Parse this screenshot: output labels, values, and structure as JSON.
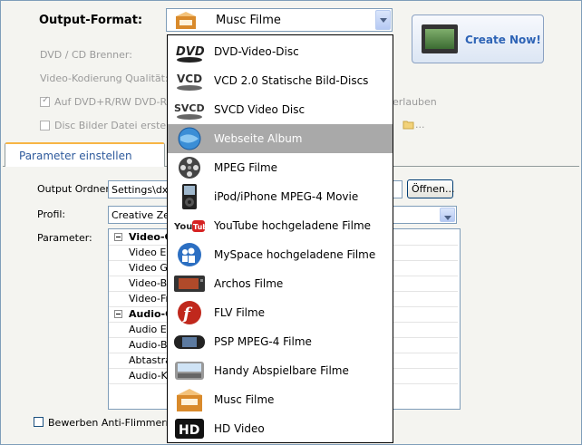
{
  "output_format": {
    "label": "Output-Format:",
    "selected": "Musc Filme"
  },
  "create_button": {
    "label": "Create Now!"
  },
  "settings": {
    "burner_label": "DVD / CD Brenner:",
    "encoding_label": "Video-Kodierung Qualität:",
    "burn_checkbox_label": "Auf DVD+R/RW DVD-R/",
    "allow_suffix": "erlauben",
    "disc_image_label": "Disc Bilder Datei ersteller",
    "folder_ellipsis": "..."
  },
  "tab": {
    "label": "Parameter einstellen"
  },
  "form": {
    "output_folder_label": "Output Ordner:",
    "output_folder_value": "Settings\\dx\\",
    "open_button": "Öffnen...",
    "profile_label": "Profil:",
    "profile_value": "Creative Zen",
    "parameter_label": "Parameter:",
    "antiflicker_label": "Bewerben Anti-Flimmern Filt"
  },
  "parameters": [
    {
      "text": "Video-C",
      "group": true
    },
    {
      "text": "Video En",
      "group": false
    },
    {
      "text": "Video Gr",
      "group": false
    },
    {
      "text": "Video-Bi",
      "group": false
    },
    {
      "text": "Video-Fr",
      "group": false
    },
    {
      "text": "Audio-C",
      "group": true
    },
    {
      "text": "Audio En",
      "group": false
    },
    {
      "text": "Audio-Bi",
      "group": false
    },
    {
      "text": "Abtastra",
      "group": false
    },
    {
      "text": "Audio-Ka",
      "group": false
    }
  ],
  "format_options": [
    {
      "label": "DVD-Video-Disc",
      "icon": "dvd-logo-icon"
    },
    {
      "label": "VCD 2.0 Statische Bild-Discs",
      "icon": "vcd-logo-icon"
    },
    {
      "label": "SVCD Video Disc",
      "icon": "svcd-logo-icon"
    },
    {
      "label": "Webseite Album",
      "icon": "globe-icon"
    },
    {
      "label": "MPEG Filme",
      "icon": "film-reel-icon"
    },
    {
      "label": "iPod/iPhone MPEG-4 Movie",
      "icon": "ipod-icon"
    },
    {
      "label": "YouTube hochgeladene Filme",
      "icon": "youtube-icon"
    },
    {
      "label": "MySpace hochgeladene Filme",
      "icon": "myspace-icon"
    },
    {
      "label": "Archos Filme",
      "icon": "archos-player-icon"
    },
    {
      "label": "FLV Filme",
      "icon": "flash-icon"
    },
    {
      "label": "PSP MPEG-4 Filme",
      "icon": "psp-icon"
    },
    {
      "label": "Handy Abspielbare Filme",
      "icon": "phone-icon"
    },
    {
      "label": "Musc Filme",
      "icon": "music-box-icon"
    },
    {
      "label": "HD Video",
      "icon": "hd-icon"
    }
  ],
  "selected_option_index": 3
}
